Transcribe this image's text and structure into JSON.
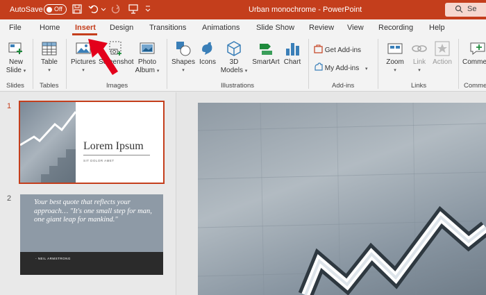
{
  "titlebar": {
    "autosave_label": "AutoSave",
    "autosave_state": "Off",
    "document_title": "Urban monochrome  -  PowerPoint",
    "search_label": "Se",
    "bg_color": "#c43e1c"
  },
  "tabs": [
    "File",
    "Home",
    "Insert",
    "Design",
    "Transitions",
    "Animations",
    "Slide Show",
    "Review",
    "View",
    "Recording",
    "Help"
  ],
  "active_tab": "Insert",
  "ribbon": {
    "new_slide": [
      "New",
      "Slide"
    ],
    "table": "Table",
    "pictures": "Pictures",
    "screenshot": "Screenshot",
    "photo_album": [
      "Photo",
      "Album"
    ],
    "shapes": "Shapes",
    "icons": "Icons",
    "models_3d": [
      "3D",
      "Models"
    ],
    "smartart": "SmartArt",
    "chart": "Chart",
    "get_addins": "Get Add-ins",
    "my_addins": "My Add-ins",
    "zoom": "Zoom",
    "link": "Link",
    "action": "Action",
    "comment": "Comme",
    "groups": {
      "slides": "Slides",
      "tables": "Tables",
      "images": "Images",
      "illustrations": "Illustrations",
      "addins": "Add-ins",
      "links": "Links",
      "comments": "Comme"
    }
  },
  "slides": [
    {
      "number": "1",
      "title": "Lorem Ipsum",
      "subtitle": "SIT DOLOR AMET"
    },
    {
      "number": "2",
      "quote": "Your best quote that reflects your approach… \"It's one small step for man, one giant leap for mankind.\"",
      "author": "- NEIL ARMSTRONG"
    }
  ],
  "colors": {
    "accent": "#c43e1c",
    "annotation_arrow": "#e3001b"
  }
}
